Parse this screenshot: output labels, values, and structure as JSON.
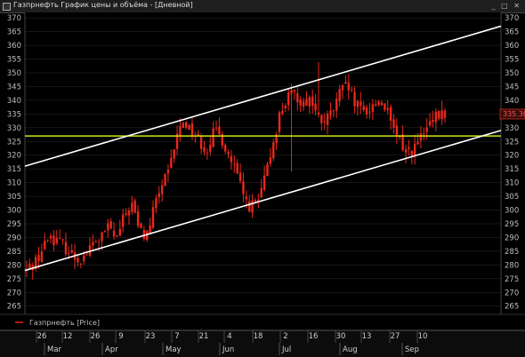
{
  "window": {
    "title": "Газпрнефть График цены и объёма - [Дневной]",
    "buttons": "_ □ ✕"
  },
  "legend": {
    "label": "Газпрнефть [Price]"
  },
  "price_label": "335.30",
  "colors": {
    "background": "#000000",
    "candle": "#e8281c",
    "support_line": "#d2e21c",
    "channel": "#ffffff",
    "grid": "#2c2c2c"
  },
  "x_axis": {
    "day_ticks": [
      "26",
      "12",
      "26",
      "9",
      "23",
      "7",
      "21",
      "4",
      "18",
      "2",
      "16",
      "30",
      "13",
      "27",
      "10"
    ],
    "month_ticks": [
      "Mar",
      "Apr",
      "May",
      "Jun",
      "Jul",
      "Aug",
      "Sep"
    ]
  },
  "chart_data": {
    "type": "line",
    "series": [
      {
        "name": "Газпрнефть [Price]",
        "values": [
          278,
          281,
          285,
          291,
          289,
          287,
          284,
          282,
          284,
          288,
          290,
          294,
          289,
          297,
          303,
          293,
          290,
          300,
          309,
          313,
          326,
          333,
          329,
          326,
          322,
          328,
          327,
          320,
          314,
          305,
          301,
          303,
          312,
          325,
          336,
          341,
          342,
          339,
          341,
          333,
          332,
          336,
          343,
          345,
          338,
          336,
          337,
          340,
          338,
          329,
          325,
          321,
          323,
          327,
          331,
          334,
          335
        ]
      }
    ],
    "y_range": [
      262,
      372
    ],
    "y_ticks": [
      265,
      270,
      275,
      280,
      285,
      290,
      295,
      300,
      305,
      310,
      315,
      320,
      325,
      330,
      335,
      340,
      345,
      350,
      355,
      360,
      365,
      370
    ],
    "horizontal_line": 327,
    "channel_upper": [
      316,
      367
    ],
    "channel_lower": [
      278,
      329
    ],
    "last_price": 335.3
  }
}
